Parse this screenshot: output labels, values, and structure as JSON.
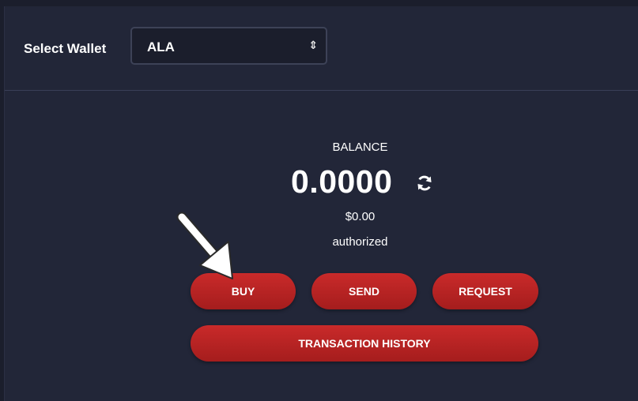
{
  "header": {
    "select_label": "Select Wallet",
    "wallet_selected": "ALA",
    "dropdown_icon": "updown-arrows-icon"
  },
  "balance": {
    "label": "BALANCE",
    "amount": "0.0000",
    "usd": "$0.00",
    "status": "authorized",
    "refresh_icon": "refresh-icon"
  },
  "actions": {
    "buy": "BUY",
    "send": "SEND",
    "request": "REQUEST",
    "history": "TRANSACTION HISTORY"
  },
  "colors": {
    "background": "#222638",
    "button": "#b82323",
    "text": "#ffffff"
  }
}
